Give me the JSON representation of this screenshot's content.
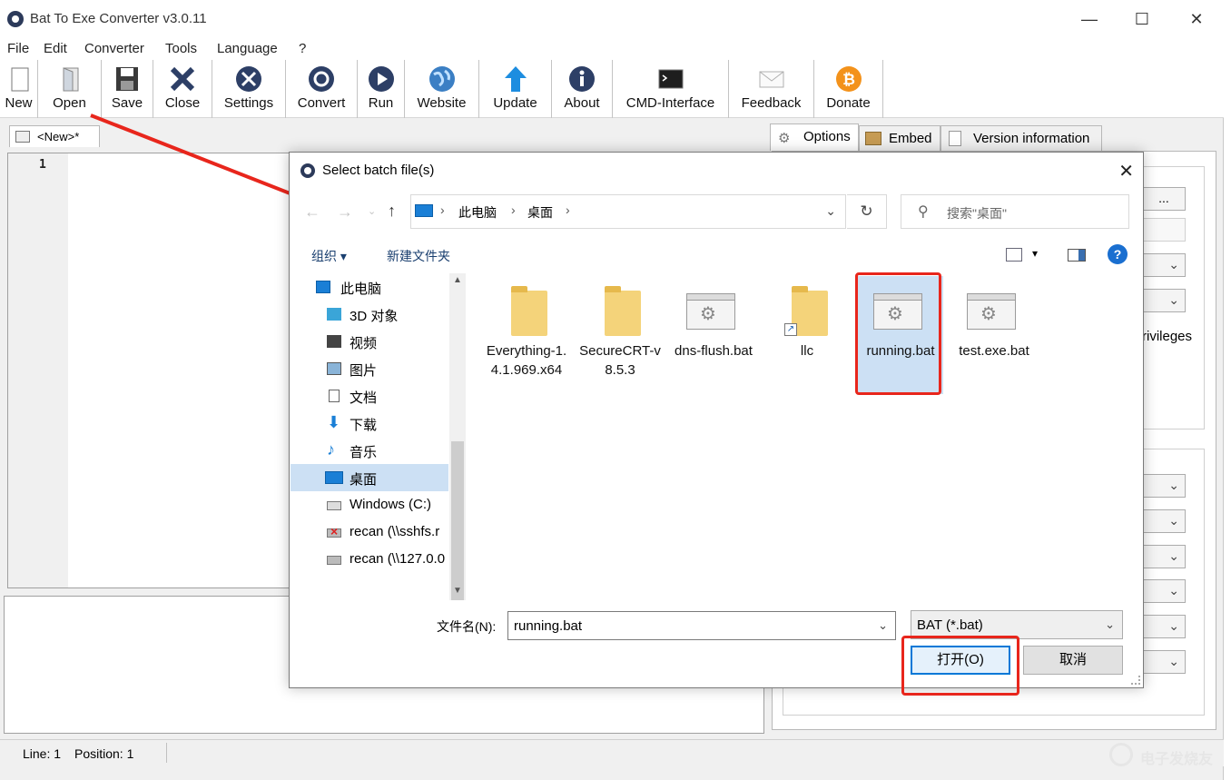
{
  "window": {
    "title": "Bat To Exe Converter v3.0.11",
    "minimize": "—",
    "maximize": "☐",
    "close": "✕"
  },
  "menu": [
    "File",
    "Edit",
    "Converter",
    "Tools",
    "Language",
    "?"
  ],
  "toolbar": [
    {
      "label": "New",
      "icon": "new-file-icon"
    },
    {
      "label": "Open",
      "icon": "open-file-icon"
    },
    {
      "label": "Save",
      "icon": "save-icon"
    },
    {
      "label": "Close",
      "icon": "close-x-icon"
    },
    {
      "label": "Settings",
      "icon": "settings-icon"
    },
    {
      "label": "Convert",
      "icon": "convert-gear-icon"
    },
    {
      "label": "Run",
      "icon": "run-play-icon"
    },
    {
      "label": "Website",
      "icon": "globe-icon"
    },
    {
      "label": "Update",
      "icon": "update-arrow-icon"
    },
    {
      "label": "About",
      "icon": "info-icon"
    },
    {
      "label": "CMD-Interface",
      "icon": "terminal-icon"
    },
    {
      "label": "Feedback",
      "icon": "mail-icon"
    },
    {
      "label": "Donate",
      "icon": "bitcoin-icon"
    }
  ],
  "doc_tab": {
    "label": "<New>*"
  },
  "editor": {
    "line_number": "1"
  },
  "right_tabs": [
    {
      "label": "Options",
      "icon": "options-gear-icon"
    },
    {
      "label": "Embed",
      "icon": "embed-box-icon"
    },
    {
      "label": "Version information",
      "icon": "version-doc-icon"
    }
  ],
  "right_panel": {
    "browse_button": "...",
    "privileges_text": "rivileges"
  },
  "status": {
    "line": "Line: 1",
    "position": "Position: 1"
  },
  "dialog": {
    "title": "Select batch file(s)",
    "close": "✕",
    "address": {
      "crumb_pc": "此电脑",
      "crumb_desktop": "桌面",
      "sep": "›"
    },
    "refresh": "↻",
    "search_placeholder": "搜索\"桌面\"",
    "organize": "组织 ▾",
    "new_folder": "新建文件夹",
    "help": "?",
    "nav_tree": [
      {
        "label": "此电脑",
        "icon": "this-pc-icon"
      },
      {
        "label": "3D 对象",
        "icon": "3d-objects-icon"
      },
      {
        "label": "视频",
        "icon": "video-icon"
      },
      {
        "label": "图片",
        "icon": "pictures-icon"
      },
      {
        "label": "文档",
        "icon": "documents-icon"
      },
      {
        "label": "下载",
        "icon": "downloads-icon"
      },
      {
        "label": "音乐",
        "icon": "music-icon"
      },
      {
        "label": "桌面",
        "icon": "desktop-icon",
        "selected": true
      },
      {
        "label": "Windows (C:)",
        "icon": "drive-icon"
      },
      {
        "label": "recan (\\\\sshfs.r",
        "icon": "network-drive-disconnected-icon"
      },
      {
        "label": "recan (\\\\127.0.0",
        "icon": "network-drive-icon"
      }
    ],
    "files": [
      {
        "name": "Everything-1.4.1.969.x64",
        "type": "folder"
      },
      {
        "name": "SecureCRT-v8.5.3",
        "type": "folder"
      },
      {
        "name": "dns-flush.bat",
        "type": "bat"
      },
      {
        "name": "llc",
        "type": "folder-shortcut"
      },
      {
        "name": "running.bat",
        "type": "bat",
        "selected": true
      },
      {
        "name": "test.exe.bat",
        "type": "bat"
      }
    ],
    "filename_label": "文件名(N):",
    "filename_value": "running.bat",
    "filter_value": "BAT (*.bat)",
    "open_button": "打开(O)",
    "cancel_button": "取消"
  },
  "watermark": "电子发烧友",
  "colors": {
    "annotation": "#e8261c",
    "selection": "#cce0f4",
    "accent": "#0078d7"
  }
}
